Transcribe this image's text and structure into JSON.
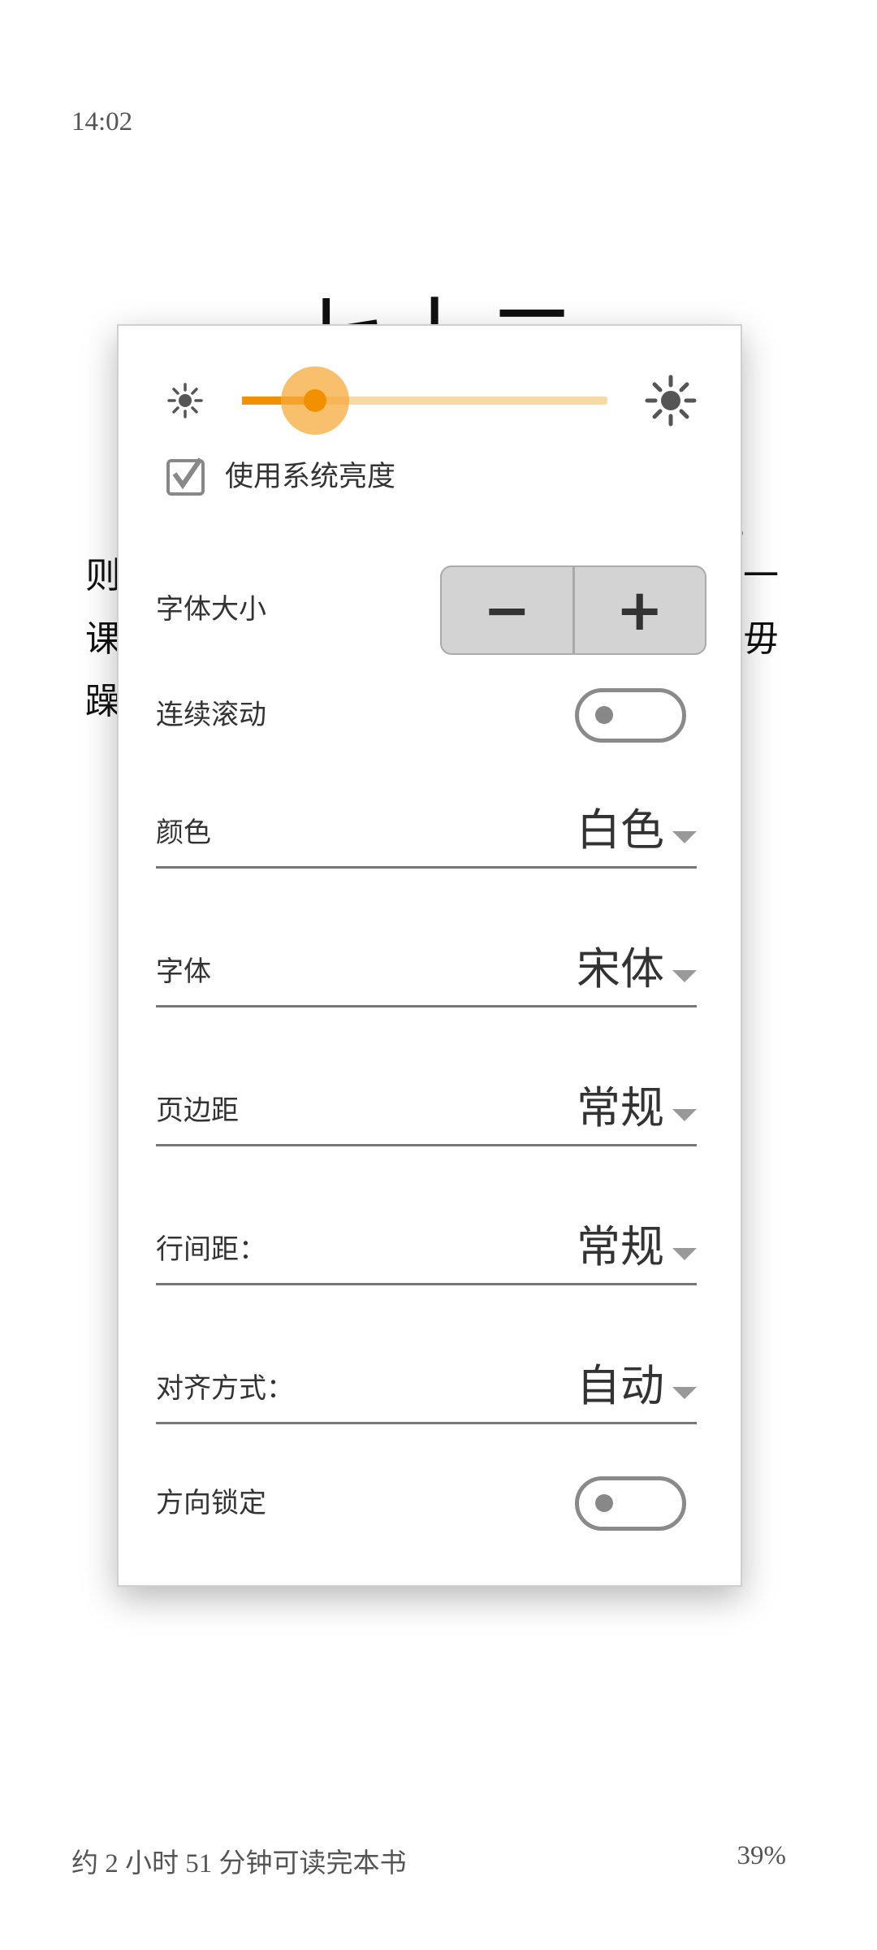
{
  "status": {
    "time": "14:02"
  },
  "book": {
    "chapter_title": "七十二",
    "line_left": [
      "则",
      "课",
      "躁"
    ],
    "line_right": [
      "，",
      "一",
      "毋"
    ]
  },
  "settings": {
    "brightness": {
      "level_percent": 20,
      "accent": "#f29100",
      "icon_low": "sun-small-icon",
      "icon_high": "sun-large-icon"
    },
    "use_system_brightness": {
      "label": "使用系统亮度",
      "checked": true
    },
    "font_size": {
      "label": "字体大小",
      "decrease": "−",
      "increase": "+"
    },
    "continuous_scroll": {
      "label": "连续滚动",
      "on": false
    },
    "dropdowns": [
      {
        "label": "颜色",
        "value": "白色"
      },
      {
        "label": "字体",
        "value": "宋体"
      },
      {
        "label": "页边距",
        "value": "常规"
      },
      {
        "label": "行间距：",
        "value": "常规"
      },
      {
        "label": "对齐方式：",
        "value": "自动"
      }
    ],
    "orientation_lock": {
      "label": "方向锁定",
      "on": false
    }
  },
  "footer": {
    "time_left": "约 2 小时 51 分钟可读完本书",
    "progress": "39%"
  }
}
